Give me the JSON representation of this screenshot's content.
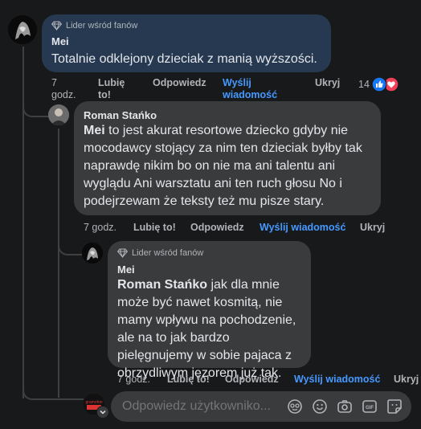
{
  "comments": [
    {
      "badge": "Lider wśród fanów",
      "author": "Mei",
      "text": "Totalnie odklejony dzieciak z manią wyższości.",
      "actions": {
        "time": "7 godz.",
        "like": "Lubię to!",
        "reply": "Odpowiedz",
        "message": "Wyślij wiadomość",
        "hide": "Ukryj"
      },
      "reactions_count": "14"
    },
    {
      "author": "Roman Stańko",
      "mention": "Mei",
      "text": " to jest akurat resortowe dziecko gdyby nie mocodawcy stojący za nim ten dzieciak byłby tak naprawdę nikim bo on nie ma ani talentu ani wyglądu Ani warsztatu ani ten ruch głosu No i podejrzewam że teksty też mu pisze stary.",
      "actions": {
        "time": "7 godz.",
        "like": "Lubię to!",
        "reply": "Odpowiedz",
        "message": "Wyślij wiadomość",
        "hide": "Ukryj"
      }
    },
    {
      "badge": "Lider wśród fanów",
      "author": "Mei",
      "mention": "Roman Stańko",
      "text": " jak dla mnie może być nawet kosmitą, nie mamy wpływu na pochodzenie, ale na to jak bardzo pielęgnujemy w sobie pajaca z obrzydliwym jęzorem już tak.",
      "actions": {
        "time": "7 godz.",
        "like": "Lubię to!",
        "reply": "Odpowiedz",
        "message": "Wyślij wiadomość",
        "hide": "Ukryj"
      }
    }
  ],
  "reply_box": {
    "placeholder": "Odpowiedz użytkowniko..."
  },
  "colors": {
    "background": "#18191a",
    "highlight_bubble": "#263951",
    "bubble": "#3a3b3c",
    "link": "#4599ff",
    "like_reaction": "#1877f2",
    "love_reaction": "#f33e58"
  },
  "icons": [
    "diamond-icon",
    "like-reaction-icon",
    "love-reaction-icon",
    "sticker-icon",
    "emoji-icon",
    "camera-icon",
    "gif-icon",
    "sticker-square-icon",
    "chevron-down-icon"
  ]
}
